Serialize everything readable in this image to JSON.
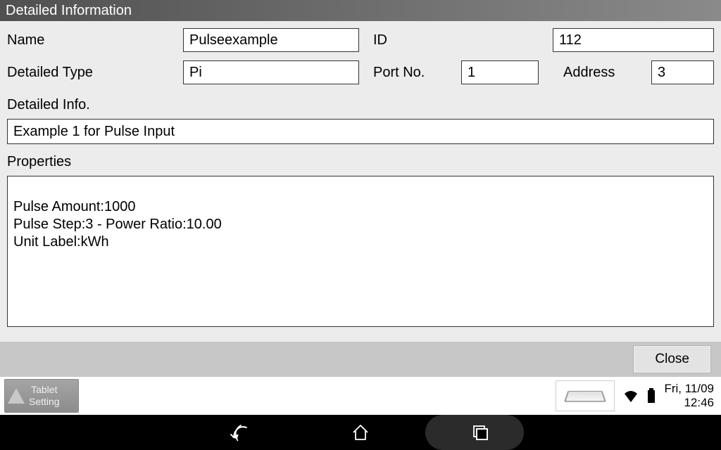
{
  "window": {
    "title": "Detailed Information"
  },
  "form": {
    "name_label": "Name",
    "name_value": "Pulseexample",
    "id_label": "ID",
    "id_value": "112",
    "type_label": "Detailed Type",
    "type_value": "Pi",
    "port_label": "Port No.",
    "port_value": "1",
    "address_label": "Address",
    "address_value": "3",
    "detailed_info_label": "Detailed Info.",
    "detailed_info_value": "Example 1 for Pulse Input",
    "properties_label": "Properties",
    "properties_value": "Pulse Amount:1000\nPulse Step:3 - Power Ratio:10.00\nUnit Label:kWh"
  },
  "footer": {
    "close_label": "Close"
  },
  "status": {
    "tablet_setting_line1": "Tablet",
    "tablet_setting_line2": "Setting",
    "date": "Fri, 11/09",
    "time": "12:46"
  }
}
